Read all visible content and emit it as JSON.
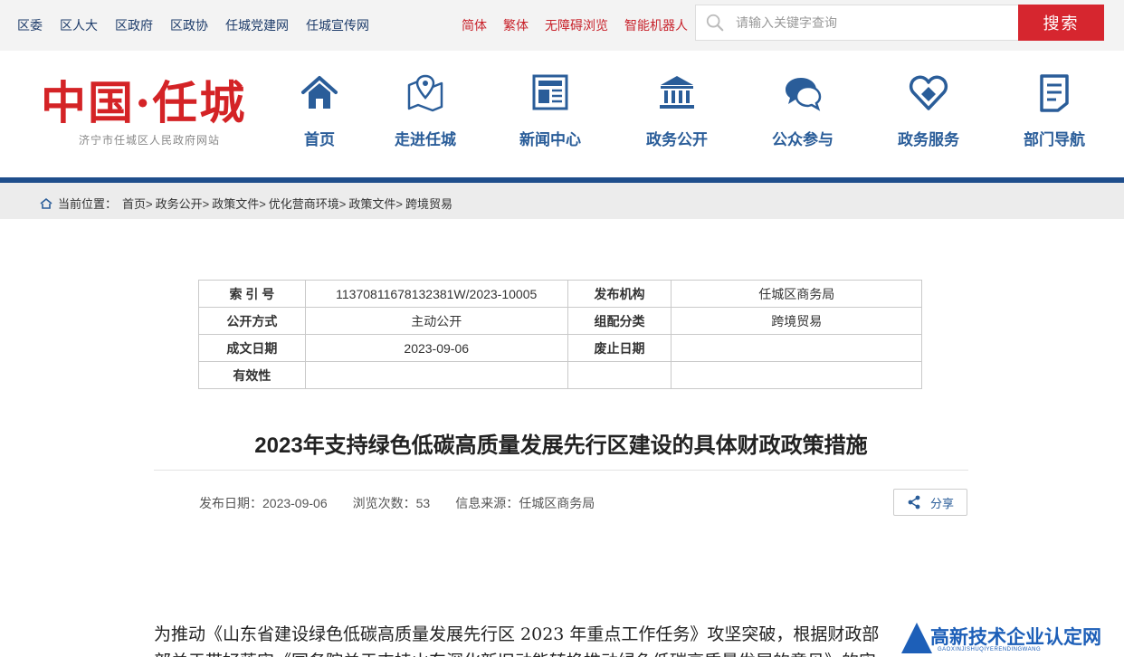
{
  "topbar": {
    "links": [
      "区委",
      "区人大",
      "区政府",
      "区政协",
      "任城党建网",
      "任城宣传网"
    ],
    "tools": [
      "简体",
      "繁体",
      "无障碍浏览",
      "智能机器人"
    ],
    "search_placeholder": "请输入关键字查询",
    "search_button": "搜索"
  },
  "header": {
    "logo_text": "中国·任城",
    "logo_subtitle": "济宁市任城区人民政府网站",
    "nav": [
      "首页",
      "走进任城",
      "新闻中心",
      "政务公开",
      "公众参与",
      "政务服务",
      "部门导航"
    ]
  },
  "breadcrumb": {
    "prefix": "当前位置：",
    "items": [
      "首页>",
      "政务公开>",
      "政策文件>",
      "优化营商环境>",
      "政策文件>",
      "跨境贸易"
    ]
  },
  "info": {
    "rows": [
      {
        "k1": "索 引 号",
        "v1": "11370811678132381W/2023-10005",
        "k2": "发布机构",
        "v2": "任城区商务局"
      },
      {
        "k1": "公开方式",
        "v1": "主动公开",
        "k2": "组配分类",
        "v2": "跨境贸易"
      },
      {
        "k1": "成文日期",
        "v1": "2023-09-06",
        "k2": "废止日期",
        "v2": ""
      },
      {
        "k1": "有效性",
        "v1": "",
        "k2": "",
        "v2": ""
      }
    ]
  },
  "article": {
    "title": "2023年支持绿色低碳高质量发展先行区建设的具体财政政策措施",
    "publish_date": "发布日期：2023-09-06",
    "views": "浏览次数：53",
    "source": "信息来源：任城区商务局",
    "share": "分享",
    "body_line1": "为推动《山东省建设绿色低碳高质量发展先行区 2023 年重点工作任务》攻坚突破，根据财政部",
    "body_line2": "部关于带好落实《国务院关于支持山东深化新旧动能转换推动绿色低碳高质量发展的意见》的实"
  },
  "watermark": {
    "text": "高新技术企业认定网",
    "sub": "GAOXINJISHUQIYERENDINGWANG"
  }
}
